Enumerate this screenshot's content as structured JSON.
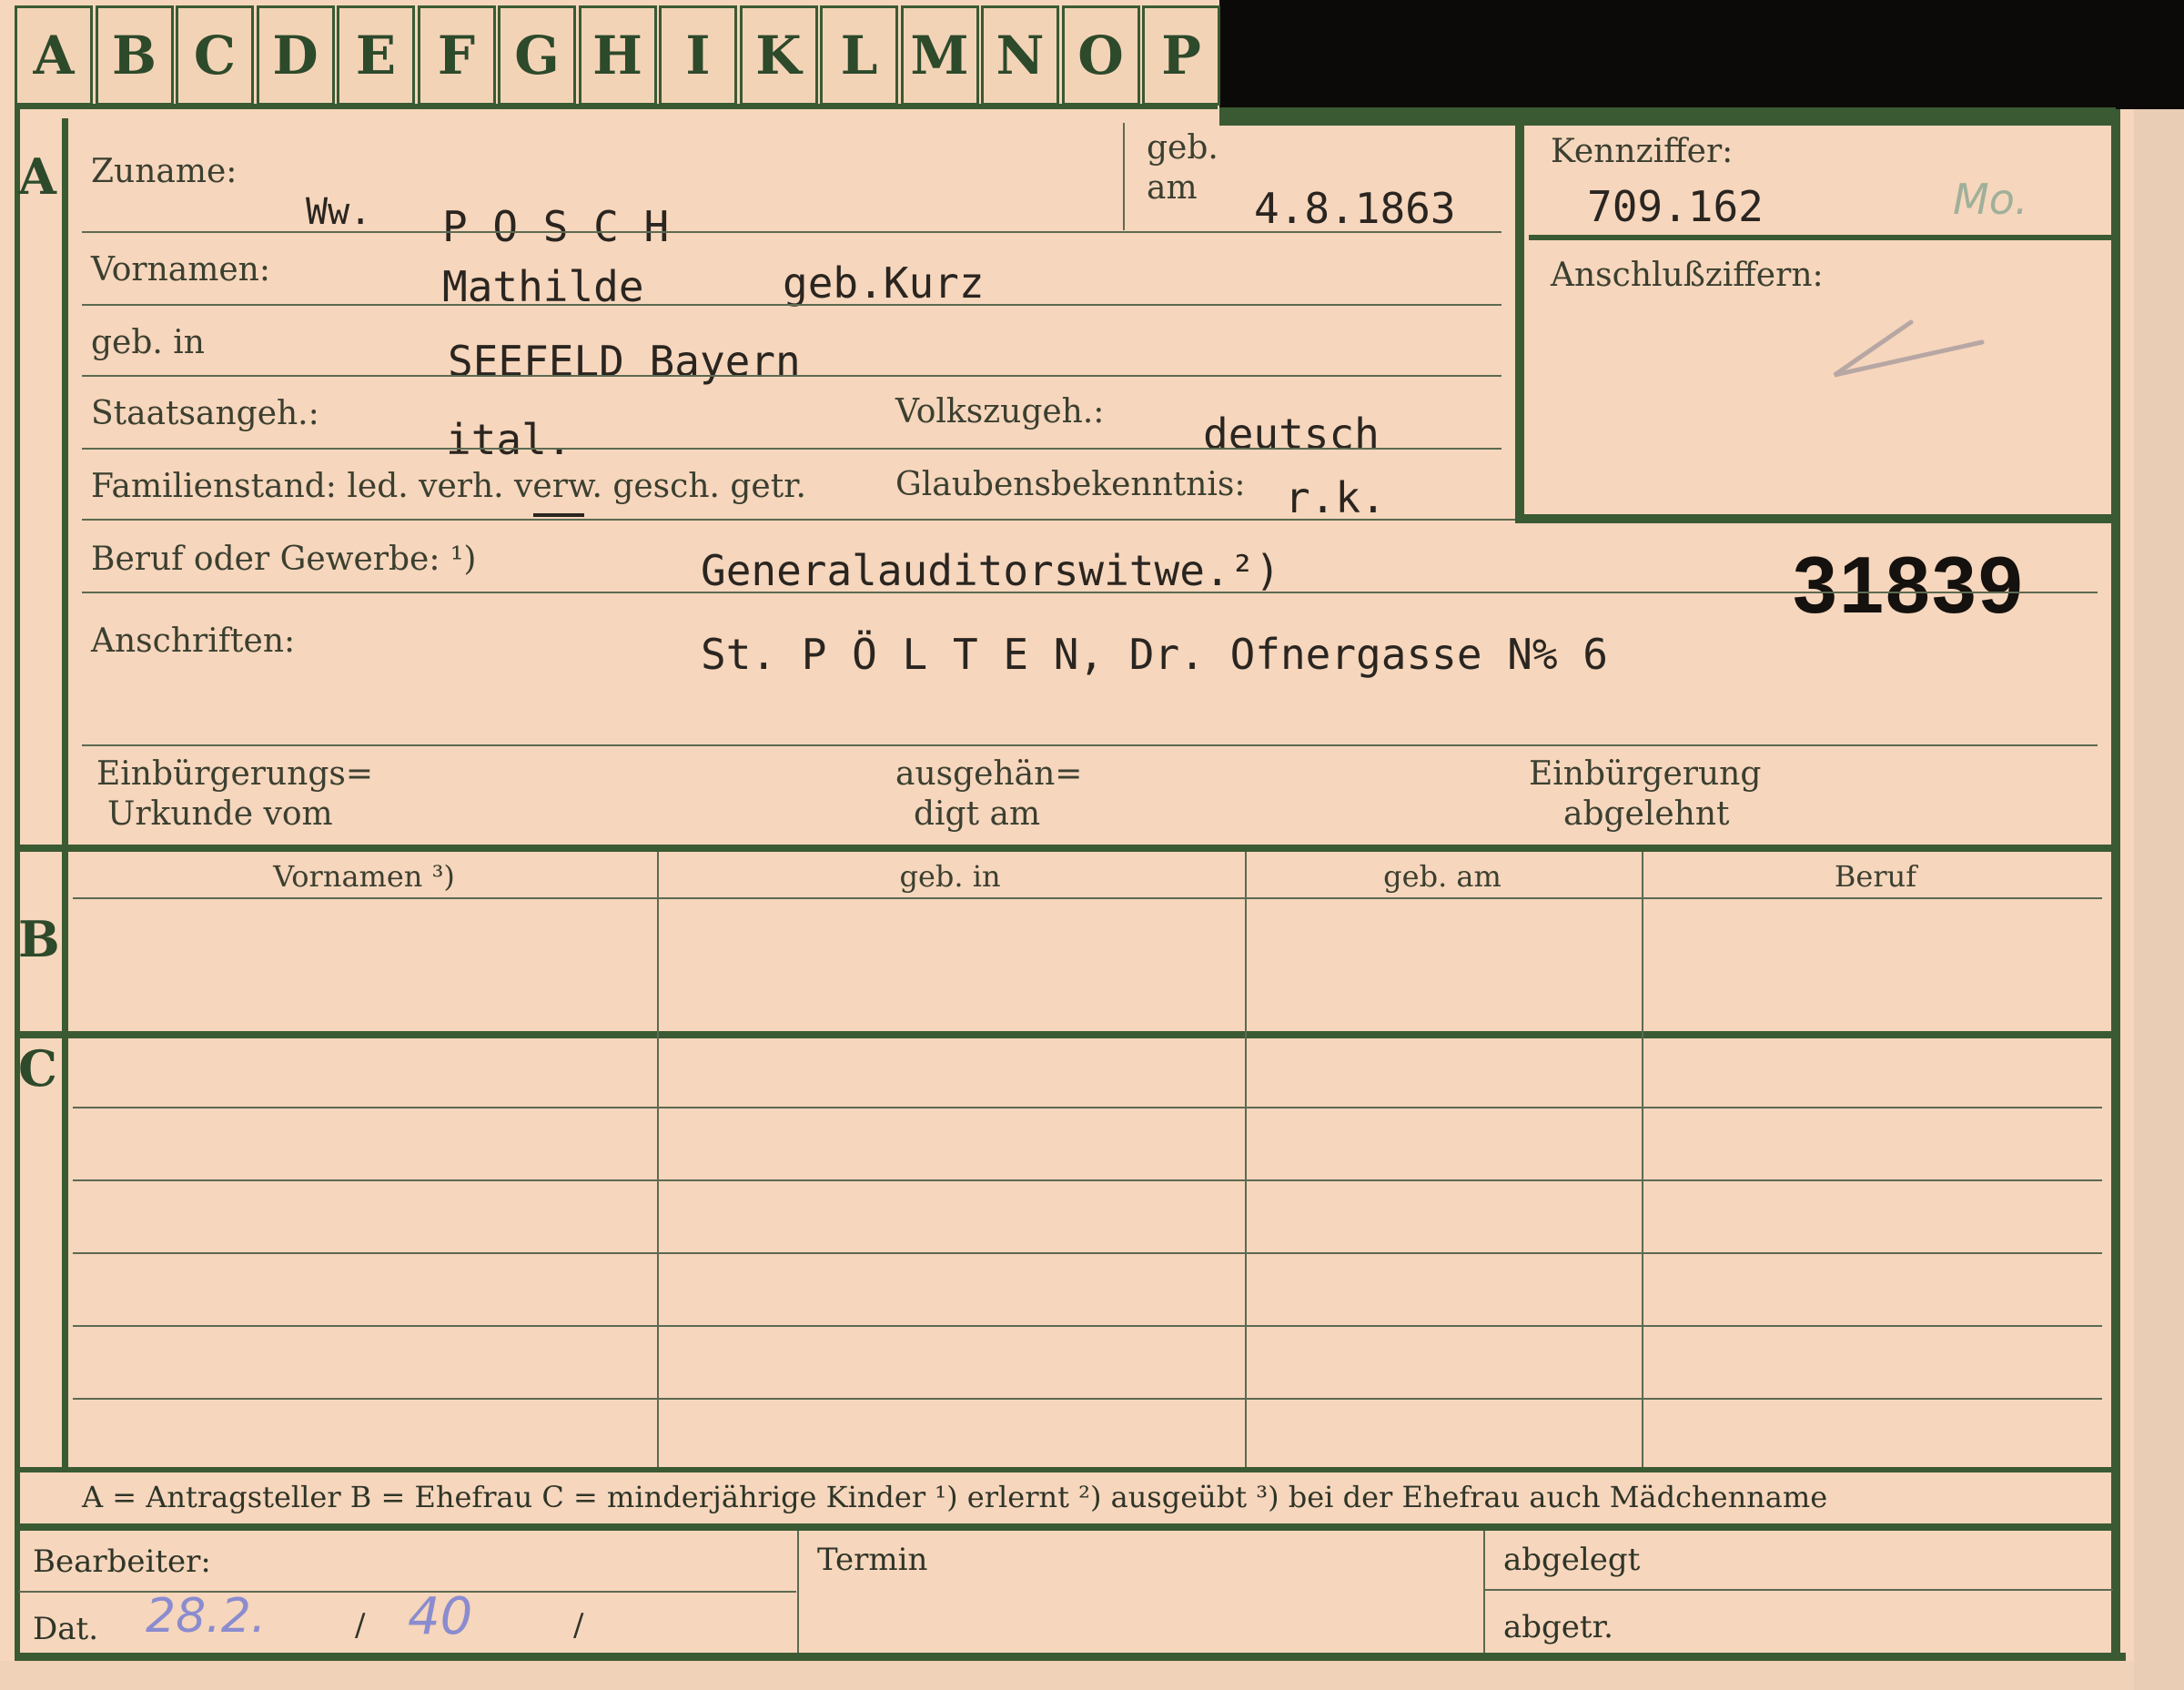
{
  "tabs": [
    "A",
    "B",
    "C",
    "D",
    "E",
    "F",
    "G",
    "H",
    "I",
    "K",
    "L",
    "M",
    "N",
    "O",
    "P"
  ],
  "sections": {
    "a": "A",
    "b": "B",
    "c": "C"
  },
  "labels": {
    "zuname": "Zuname:",
    "geb_am_1": "geb.",
    "geb_am_2": "am",
    "vornamen": "Vornamen:",
    "geb_in": "geb. in",
    "staatsangeh": "Staatsangeh.:",
    "volkszugeh": "Volkszugeh.:",
    "familienstand": "Familienstand: led. verh. verw. gesch. getr.",
    "glaubensbekenntnis": "Glaubensbekenntnis:",
    "beruf": "Beruf oder Gewerbe: ¹)",
    "anschriften": "Anschriften:",
    "kennziffer": "Kennziffer:",
    "anschlussziffern": "Anschlußziffern:",
    "einbuergerungsurkunde_1": "Einbürgerungs=",
    "einbuergerungsurkunde_2": "Urkunde vom",
    "ausgehaendigt_1": "ausgehän=",
    "ausgehaendigt_2": "digt am",
    "einbuergerung_abgelehnt_1": "Einbürgerung",
    "einbuergerung_abgelehnt_2": "abgelehnt"
  },
  "values": {
    "ww": "Ww.",
    "zuname": "P O S C H",
    "geb_am": "4.8.1863",
    "vornamen": "Mathilde",
    "geb_name": "geb.Kurz",
    "geb_in": "SEEFELD Bayern",
    "staatsangeh": "ital.",
    "volkszugeh": "deutsch",
    "glaubensbekenntnis": "r.k.",
    "beruf": "Generalauditorswitwe.²)",
    "anschrift": "St. P Ö L T E N, Dr. Ofnergasse N% 6",
    "kennziffer": "709.162",
    "kennziffer_note": "Mo.",
    "number_stamp": "31839"
  },
  "table": {
    "headers": [
      "Vornamen ³)",
      "geb. in",
      "geb. am",
      "Beruf"
    ]
  },
  "legend": "A = Antragsteller   B = Ehefrau   C = minderjährige Kinder   ¹) erlernt   ²) ausgeübt   ³) bei der Ehefrau auch Mädchenname",
  "footer": {
    "bearbeiter": "Bearbeiter:",
    "dat": "Dat.",
    "termin": "Termin",
    "abgelegt": "abgelegt",
    "abgetr": "abgetr.",
    "date_day": "28.2.",
    "date_year": "40"
  }
}
